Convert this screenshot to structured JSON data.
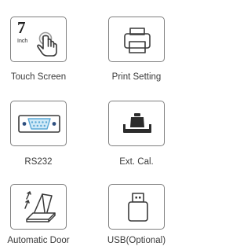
{
  "menu": {
    "items": [
      {
        "label": "Touch Screen",
        "icon": "touch-screen-icon",
        "badge_number": "7",
        "badge_unit": "Inch"
      },
      {
        "label": "Print Setting",
        "icon": "printer-icon"
      },
      {
        "label": "RS232",
        "icon": "serial-port-icon"
      },
      {
        "label": "Ext. Cal.",
        "icon": "calibration-weight-icon"
      },
      {
        "label": "Automatic Door",
        "icon": "automatic-door-icon"
      },
      {
        "label": "USB(Optional)",
        "icon": "usb-icon"
      }
    ]
  },
  "colors": {
    "icon_stroke": "#3a3a3a",
    "tile_border": "#7f7f7f",
    "serial_port_fill": "#cfe9f7",
    "serial_port_pins": "#5aa8d6"
  }
}
